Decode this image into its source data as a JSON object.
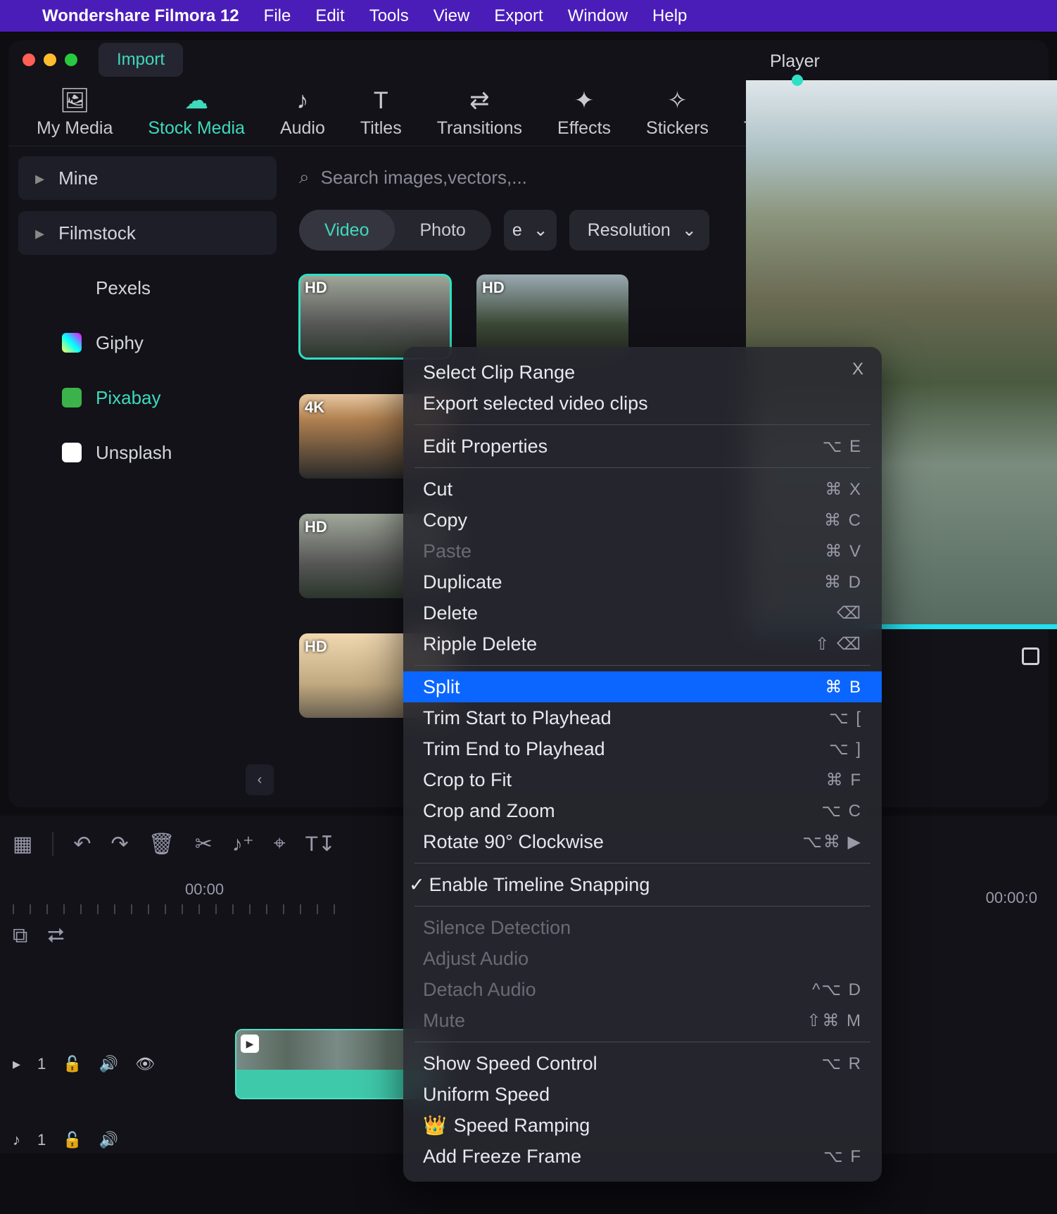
{
  "menubar": {
    "app_name": "Wondershare Filmora 12",
    "items": [
      "File",
      "Edit",
      "Tools",
      "View",
      "Export",
      "Window",
      "Help"
    ]
  },
  "window": {
    "import_label": "Import"
  },
  "toptabs": [
    {
      "label": "My Media",
      "active": false,
      "icon": "🖼"
    },
    {
      "label": "Stock Media",
      "active": true,
      "icon": "☁"
    },
    {
      "label": "Audio",
      "active": false,
      "icon": "♪"
    },
    {
      "label": "Titles",
      "active": false,
      "icon": "T"
    },
    {
      "label": "Transitions",
      "active": false,
      "icon": "⇄"
    },
    {
      "label": "Effects",
      "active": false,
      "icon": "✦"
    },
    {
      "label": "Stickers",
      "active": false,
      "icon": "✧"
    },
    {
      "label": "Temp",
      "active": false,
      "icon": "▢"
    }
  ],
  "sidebar": {
    "sections": [
      {
        "label": "Mine",
        "kind": "sec"
      },
      {
        "label": "Filmstock",
        "kind": "sec"
      },
      {
        "label": "Pexels",
        "kind": "sub",
        "icon_bg": "#16a77a"
      },
      {
        "label": "Giphy",
        "kind": "sub",
        "icon_bg": "#1f1f28"
      },
      {
        "label": "Pixabay",
        "kind": "sub",
        "icon_bg": "#3bb34a",
        "active": true
      },
      {
        "label": "Unsplash",
        "kind": "sub",
        "icon_bg": "#1f1f28"
      }
    ]
  },
  "search": {
    "placeholder": "Search images,vectors,..."
  },
  "filters": {
    "video": "Video",
    "photo": "Photo",
    "type_suffix": "e",
    "resolution": "Resolution"
  },
  "thumbs": [
    [
      {
        "badge": "HD",
        "sel": true,
        "cls": "rock"
      },
      {
        "badge": "HD",
        "cls": "fall"
      }
    ],
    [
      {
        "badge": "4K",
        "cls": "sky"
      }
    ],
    [
      {
        "badge": "HD",
        "cls": "rock"
      }
    ],
    [
      {
        "badge": "HD",
        "cls": "beach"
      }
    ]
  ],
  "player": {
    "title": "Player"
  },
  "timeline": {
    "timecode_left": "00:00",
    "timecode_right": "00:00:0",
    "video_track": "1",
    "audio_track": "1"
  },
  "ctxmenu": {
    "groups": [
      [
        {
          "label": "Select Clip Range"
        },
        {
          "label": "Export selected video clips"
        }
      ],
      [
        {
          "label": "Edit Properties",
          "shortcut": "⌥ E"
        }
      ],
      [
        {
          "label": "Cut",
          "shortcut": "⌘ X"
        },
        {
          "label": "Copy",
          "shortcut": "⌘ C"
        },
        {
          "label": "Paste",
          "shortcut": "⌘ V",
          "disabled": true
        },
        {
          "label": "Duplicate",
          "shortcut": "⌘ D"
        },
        {
          "label": "Delete",
          "shortcut": "⌫"
        },
        {
          "label": "Ripple Delete",
          "shortcut": "⇧ ⌫"
        }
      ],
      [
        {
          "label": "Split",
          "shortcut": "⌘ B",
          "highlight": true
        },
        {
          "label": "Trim Start to Playhead",
          "shortcut": "⌥ ["
        },
        {
          "label": "Trim End to Playhead",
          "shortcut": "⌥ ]"
        },
        {
          "label": "Crop to Fit",
          "shortcut": "⌘ F"
        },
        {
          "label": "Crop and Zoom",
          "shortcut": "⌥ C"
        },
        {
          "label": "Rotate 90° Clockwise",
          "shortcut": "⌥⌘ ▶"
        }
      ],
      [
        {
          "label": "Enable Timeline Snapping",
          "checked": true
        }
      ],
      [
        {
          "label": "Silence Detection",
          "disabled": true
        },
        {
          "label": "Adjust Audio",
          "disabled": true
        },
        {
          "label": "Detach Audio",
          "shortcut": "^⌥ D",
          "disabled": true
        },
        {
          "label": "Mute",
          "shortcut": "⇧⌘ M",
          "disabled": true
        }
      ],
      [
        {
          "label": "Show Speed Control",
          "shortcut": "⌥ R"
        },
        {
          "label": "Uniform Speed"
        },
        {
          "label": "Speed Ramping",
          "crown": true
        },
        {
          "label": "Add Freeze Frame",
          "shortcut": "⌥ F"
        }
      ]
    ],
    "close": "X"
  }
}
